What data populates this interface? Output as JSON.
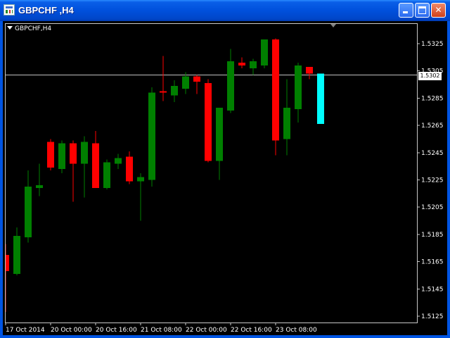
{
  "window": {
    "title": "GBPCHF ,H4",
    "buttons": [
      "minimize-button",
      "maximize-button",
      "close-button"
    ]
  },
  "chart": {
    "symbol_label": "GBPCHF,H4",
    "current_price_label": "1.5302",
    "background": "#000000",
    "bull_color": "#008000",
    "bear_color": "#FF0000",
    "current_candle_color": "#00FFFF",
    "line_color": "#C0C0C0"
  },
  "chart_data": {
    "type": "candlestick",
    "symbol": "GBPCHF",
    "timeframe": "H4",
    "ylim": [
      1.5115,
      1.5335
    ],
    "y_ticks": [
      "1.5325",
      "1.5305",
      "1.5285",
      "1.5265",
      "1.5245",
      "1.5225",
      "1.5205",
      "1.5185",
      "1.5165",
      "1.5145",
      "1.5125"
    ],
    "x_ticks": [
      {
        "label": "17 Oct 2014",
        "index": 0
      },
      {
        "label": "20 Oct 00:00",
        "index": 4
      },
      {
        "label": "20 Oct 16:00",
        "index": 8
      },
      {
        "label": "21 Oct 08:00",
        "index": 12
      },
      {
        "label": "22 Oct 00:00",
        "index": 16
      },
      {
        "label": "22 Oct 16:00",
        "index": 20
      },
      {
        "label": "23 Oct 08:00",
        "index": 24
      }
    ],
    "current_price": 1.5302,
    "candles": [
      {
        "o": 1.517,
        "h": 1.5178,
        "l": 1.5128,
        "c": 1.5158
      },
      {
        "o": 1.5156,
        "h": 1.519,
        "l": 1.5155,
        "c": 1.5184
      },
      {
        "o": 1.5183,
        "h": 1.5232,
        "l": 1.5179,
        "c": 1.522
      },
      {
        "o": 1.5219,
        "h": 1.5237,
        "l": 1.5213,
        "c": 1.5221
      },
      {
        "o": 1.5253,
        "h": 1.5255,
        "l": 1.5232,
        "c": 1.5234
      },
      {
        "o": 1.5233,
        "h": 1.5254,
        "l": 1.523,
        "c": 1.5252
      },
      {
        "o": 1.5252,
        "h": 1.5254,
        "l": 1.5209,
        "c": 1.5237
      },
      {
        "o": 1.5237,
        "h": 1.5257,
        "l": 1.5212,
        "c": 1.5253
      },
      {
        "o": 1.5252,
        "h": 1.5261,
        "l": 1.5219,
        "c": 1.5219
      },
      {
        "o": 1.5219,
        "h": 1.524,
        "l": 1.5218,
        "c": 1.5238
      },
      {
        "o": 1.5237,
        "h": 1.5244,
        "l": 1.5233,
        "c": 1.5241
      },
      {
        "o": 1.5242,
        "h": 1.5246,
        "l": 1.5222,
        "c": 1.5224
      },
      {
        "o": 1.5224,
        "h": 1.523,
        "l": 1.5195,
        "c": 1.5227
      },
      {
        "o": 1.5225,
        "h": 1.5293,
        "l": 1.522,
        "c": 1.5289
      },
      {
        "o": 1.529,
        "h": 1.5316,
        "l": 1.5283,
        "c": 1.5289
      },
      {
        "o": 1.5287,
        "h": 1.5298,
        "l": 1.5282,
        "c": 1.5294
      },
      {
        "o": 1.5292,
        "h": 1.5304,
        "l": 1.5288,
        "c": 1.5301
      },
      {
        "o": 1.5301,
        "h": 1.5302,
        "l": 1.5288,
        "c": 1.5297
      },
      {
        "o": 1.5296,
        "h": 1.5299,
        "l": 1.5238,
        "c": 1.5239
      },
      {
        "o": 1.5239,
        "h": 1.5277,
        "l": 1.5225,
        "c": 1.5278
      },
      {
        "o": 1.5276,
        "h": 1.5321,
        "l": 1.5274,
        "c": 1.5312
      },
      {
        "o": 1.5311,
        "h": 1.5315,
        "l": 1.5307,
        "c": 1.5309
      },
      {
        "o": 1.5307,
        "h": 1.5314,
        "l": 1.5302,
        "c": 1.5312
      },
      {
        "o": 1.5309,
        "h": 1.5328,
        "l": 1.5307,
        "c": 1.5328
      },
      {
        "o": 1.5328,
        "h": 1.5329,
        "l": 1.5243,
        "c": 1.5254
      },
      {
        "o": 1.5255,
        "h": 1.5299,
        "l": 1.5243,
        "c": 1.5278
      },
      {
        "o": 1.5277,
        "h": 1.5311,
        "l": 1.5267,
        "c": 1.5309
      },
      {
        "o": 1.5308,
        "h": 1.5308,
        "l": 1.5299,
        "c": 1.5303
      },
      {
        "o": 1.5303,
        "h": 1.5303,
        "l": 1.5266,
        "c": 1.5266
      }
    ]
  }
}
